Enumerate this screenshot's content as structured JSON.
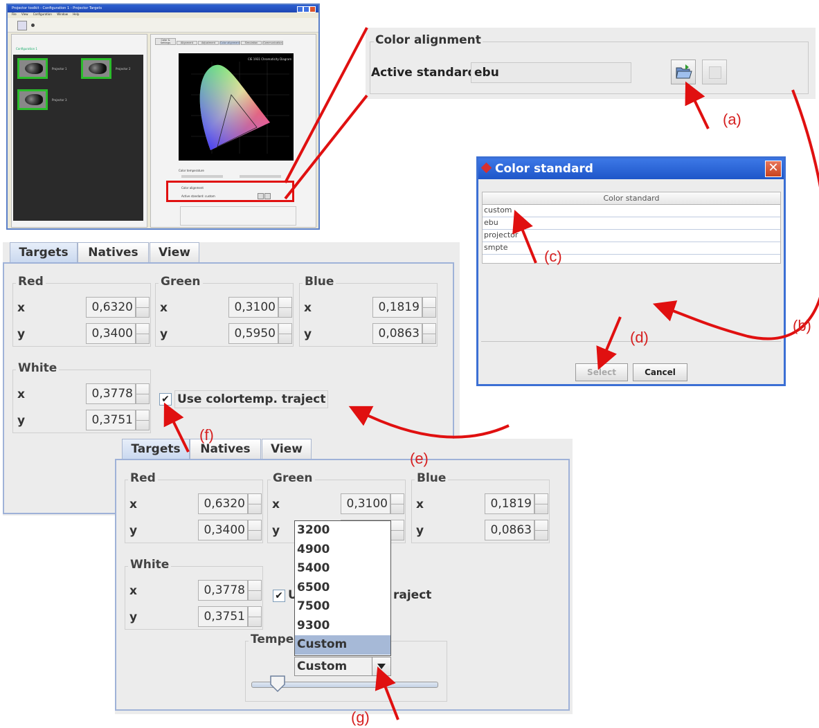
{
  "mini_screenshot": {
    "window_title": "Projector toolkit - Configuration 1 - Projector Targets",
    "menu": [
      "File",
      "View",
      "Configuration",
      "Window",
      "Help"
    ],
    "left_header": "Configuration 1",
    "thumb_labels": [
      "Projector 1",
      "Projector 2",
      "Projector 3"
    ],
    "tabs": [
      "Color & Settings",
      "Alignment",
      "Adjustment",
      "Color alignment",
      "Simulation",
      "Communication"
    ],
    "chart_title": "CIE 1931 Chromaticity Diagram",
    "section_color_temp": "Color temperature",
    "section_color_alignment": "Color alignment",
    "active_standard_small": "Active standard: custom"
  },
  "color_alignment": {
    "title": "Color alignment",
    "active_standard_label": "Active standard:",
    "active_standard_value": "ebu",
    "open_button_icon": "folder-open-icon",
    "apply_button_icon": "apply-icon"
  },
  "color_standard_dialog": {
    "title": "Color standard",
    "column_header": "Color standard",
    "rows": [
      "custom",
      "ebu",
      "projector",
      "smpte"
    ],
    "select_label": "Select",
    "cancel_label": "Cancel"
  },
  "targets_panel": {
    "tabs": [
      "Targets",
      "Natives",
      "View"
    ],
    "red": {
      "title": "Red",
      "x_label": "x",
      "y_label": "y",
      "x": "0,6320",
      "y": "0,3400"
    },
    "green": {
      "title": "Green",
      "x_label": "x",
      "y_label": "y",
      "x": "0,3100",
      "y": "0,5950"
    },
    "blue": {
      "title": "Blue",
      "x_label": "x",
      "y_label": "y",
      "x": "0,1819",
      "y": "0,0863"
    },
    "white": {
      "title": "White",
      "x_label": "x",
      "y_label": "y",
      "x": "0,3778",
      "y": "0,3751"
    },
    "use_colortemp_label": "Use colortemp. traject",
    "use_colortemp_checked": true
  },
  "targets_panel_2": {
    "tabs": [
      "Targets",
      "Natives",
      "View"
    ],
    "red": {
      "title": "Red",
      "x_label": "x",
      "y_label": "y",
      "x": "0,6320",
      "y": "0,3400"
    },
    "green": {
      "title": "Green",
      "x_label": "x",
      "y_label": "y",
      "x": "0,3100",
      "y": ""
    },
    "blue": {
      "title": "Blue",
      "x_label": "x",
      "y_label": "y",
      "x": "0,1819",
      "y": "0,0863"
    },
    "white": {
      "title": "White",
      "x_label": "x",
      "y_label": "y",
      "x": "0,3778",
      "y": "0,3751"
    },
    "use_colortemp_label_partial_1": "U",
    "use_colortemp_label_partial_2": "raject",
    "temperature_title": "Temper",
    "temperature_options": [
      "3200",
      "4900",
      "5400",
      "6500",
      "7500",
      "9300",
      "Custom"
    ],
    "temperature_selected": "Custom"
  },
  "annotations": [
    "(a)",
    "(b)",
    "(c)",
    "(d)",
    "(e)",
    "(f)",
    "(g)"
  ],
  "colors": {
    "highlight": "#e01010",
    "xp_blue": "#1f56c9",
    "selection": "#a6b9d7",
    "panel_bg": "#ececec"
  }
}
